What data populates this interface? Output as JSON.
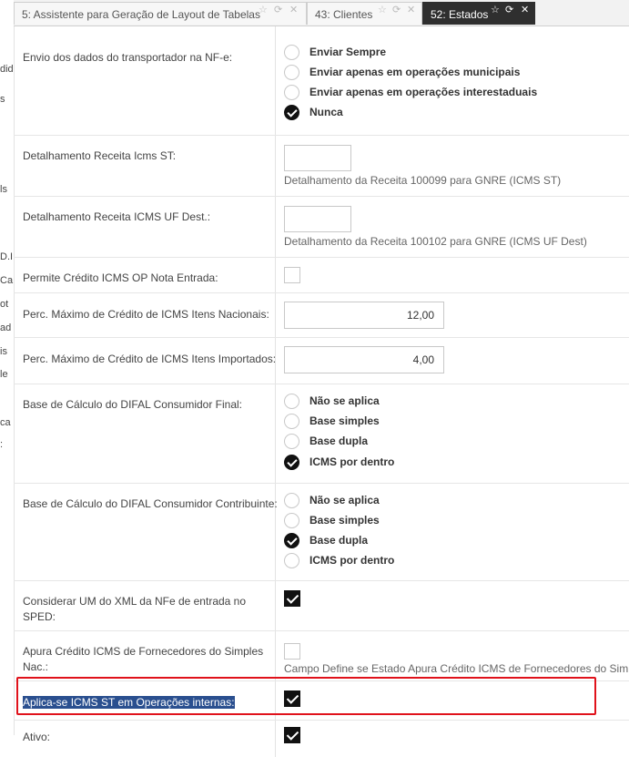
{
  "sidebar_fragments": [
    "dida",
    "s",
    "ls",
    "D.I",
    "Ca",
    "ot",
    "ad",
    "is",
    "le",
    "ca",
    ":"
  ],
  "tabs": [
    {
      "label": "5: Assistente para Geração de Layout de Tabelas",
      "active": false
    },
    {
      "label": "43: Clientes",
      "active": false
    },
    {
      "label": "52: Estados",
      "active": true
    }
  ],
  "tab_icons": {
    "favorite": "☆",
    "refresh": "⟳",
    "close": "✕"
  },
  "form": {
    "envio": {
      "label": "Envio dos dados do transportador na NF-e:",
      "options": [
        {
          "label": "Enviar Sempre",
          "selected": false
        },
        {
          "label": "Enviar apenas em operações municipais",
          "selected": false
        },
        {
          "label": "Enviar apenas em operações interestaduais",
          "selected": false
        },
        {
          "label": "Nunca",
          "selected": true
        }
      ]
    },
    "det_icms_st": {
      "label": "Detalhamento Receita Icms ST:",
      "value": "",
      "help": "Detalhamento da Receita 100099 para GNRE (ICMS ST)"
    },
    "det_icms_uf": {
      "label": "Detalhamento Receita ICMS UF Dest.:",
      "value": "",
      "help": "Detalhamento da Receita 100102 para GNRE (ICMS UF Dest)"
    },
    "permite_credito": {
      "label": "Permite Crédito ICMS OP Nota Entrada:",
      "checked": false
    },
    "perc_nacionais": {
      "label": "Perc. Máximo de Crédito de ICMS Itens Nacionais:",
      "value": "12,00"
    },
    "perc_importados": {
      "label": "Perc. Máximo de Crédito de ICMS Itens Importados:",
      "value": "4,00"
    },
    "difal_final": {
      "label": "Base de Cálculo do DIFAL Consumidor Final:",
      "options": [
        {
          "label": "Não se aplica",
          "selected": false
        },
        {
          "label": "Base simples",
          "selected": false
        },
        {
          "label": "Base dupla",
          "selected": false
        },
        {
          "label": "ICMS por dentro",
          "selected": true
        }
      ]
    },
    "difal_contrib": {
      "label": "Base de Cálculo do DIFAL Consumidor Contribuinte:",
      "options": [
        {
          "label": "Não se aplica",
          "selected": false
        },
        {
          "label": "Base simples",
          "selected": false
        },
        {
          "label": "Base dupla",
          "selected": true
        },
        {
          "label": "ICMS por dentro",
          "selected": false
        }
      ]
    },
    "considerar_um": {
      "label": "Considerar UM do XML da NFe de entrada no SPED:",
      "checked": true
    },
    "apura_credito": {
      "label": "Apura Crédito ICMS de Fornecedores do Simples Nac.:",
      "checked": false,
      "help": "Campo Define se Estado Apura Crédito ICMS de Fornecedores do Simples Nacional"
    },
    "aplica_st": {
      "label": "Aplica-se ICMS ST em Operações internas:",
      "checked": true
    },
    "ativo": {
      "label": "Ativo:",
      "checked": true
    }
  },
  "colors": {
    "accent_dark": "#2f2f2f",
    "highlight_box": "#e0121b",
    "selection": "#2a4f8f"
  }
}
